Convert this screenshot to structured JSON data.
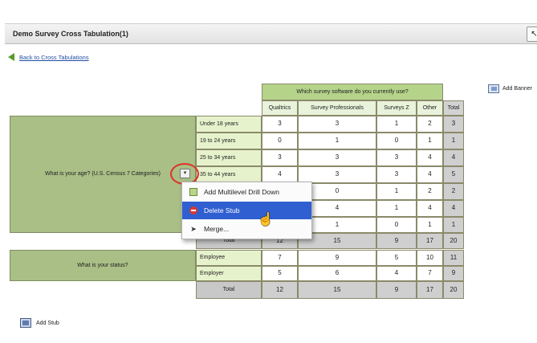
{
  "header": {
    "title": "Demo Survey Cross Tabulation(1)",
    "corner_icon": "cursor-icon",
    "corner_glyph": "↖"
  },
  "nav": {
    "back_label": "Back to Cross Tabulations"
  },
  "banner": {
    "question": "Which survey software do you currently use?",
    "columns": [
      "Qualtrics",
      "Survey Professionals",
      "Surveys Z",
      "Other"
    ],
    "total_label": "Total",
    "add_banner_label": "Add Banner"
  },
  "stubs": [
    {
      "question": "What is your age? (U.S. Census 7 Categories)",
      "rows": [
        {
          "label": "Under 18 years",
          "values": [
            "3",
            "3",
            "1",
            "2"
          ],
          "total": "3"
        },
        {
          "label": "19 to 24 years",
          "values": [
            "0",
            "1",
            "0",
            "1"
          ],
          "total": "1"
        },
        {
          "label": "25 to 34 years",
          "values": [
            "3",
            "3",
            "3",
            "4"
          ],
          "total": "4"
        },
        {
          "label": "35 to 44 years",
          "values": [
            "4",
            "3",
            "3",
            "4"
          ],
          "total": "5"
        },
        {
          "label": "",
          "values": [
            "",
            "0",
            "1",
            "2"
          ],
          "total": "2"
        },
        {
          "label": "",
          "values": [
            "",
            "4",
            "1",
            "4"
          ],
          "total": "4"
        },
        {
          "label": "",
          "values": [
            "",
            "1",
            "0",
            "1"
          ],
          "total": "1"
        }
      ],
      "total_row": {
        "label": "Total",
        "values": [
          "12",
          "15",
          "9",
          "17"
        ],
        "total": "20"
      }
    },
    {
      "question": "What is your status?",
      "rows": [
        {
          "label": "Employee",
          "values": [
            "7",
            "9",
            "5",
            "10"
          ],
          "total": "11"
        },
        {
          "label": "Employer",
          "values": [
            "5",
            "6",
            "4",
            "7"
          ],
          "total": "9"
        }
      ],
      "total_row": {
        "label": "Total",
        "values": [
          "12",
          "15",
          "9",
          "17"
        ],
        "total": "20"
      }
    }
  ],
  "context_menu": {
    "items": [
      {
        "label": "Add Multilevel Drill Down",
        "icon": "add-drilldown-icon"
      },
      {
        "label": "Delete Stub",
        "icon": "delete-icon",
        "highlighted": true
      },
      {
        "label": "Merge...",
        "icon": "merge-icon"
      }
    ],
    "dropdown_glyph": "▾",
    "merge_glyph": "➤"
  },
  "footer": {
    "add_stub_label": "Add Stub"
  },
  "pointer_glyph": "☝",
  "colors": {
    "banner_header": "#b5d48a",
    "stub_header": "#a9bf86",
    "row_label": "#e6f2cc",
    "menu_highlight": "#2f5fd0",
    "annotation_circle": "#e0302a",
    "link": "#1f4fa0"
  }
}
